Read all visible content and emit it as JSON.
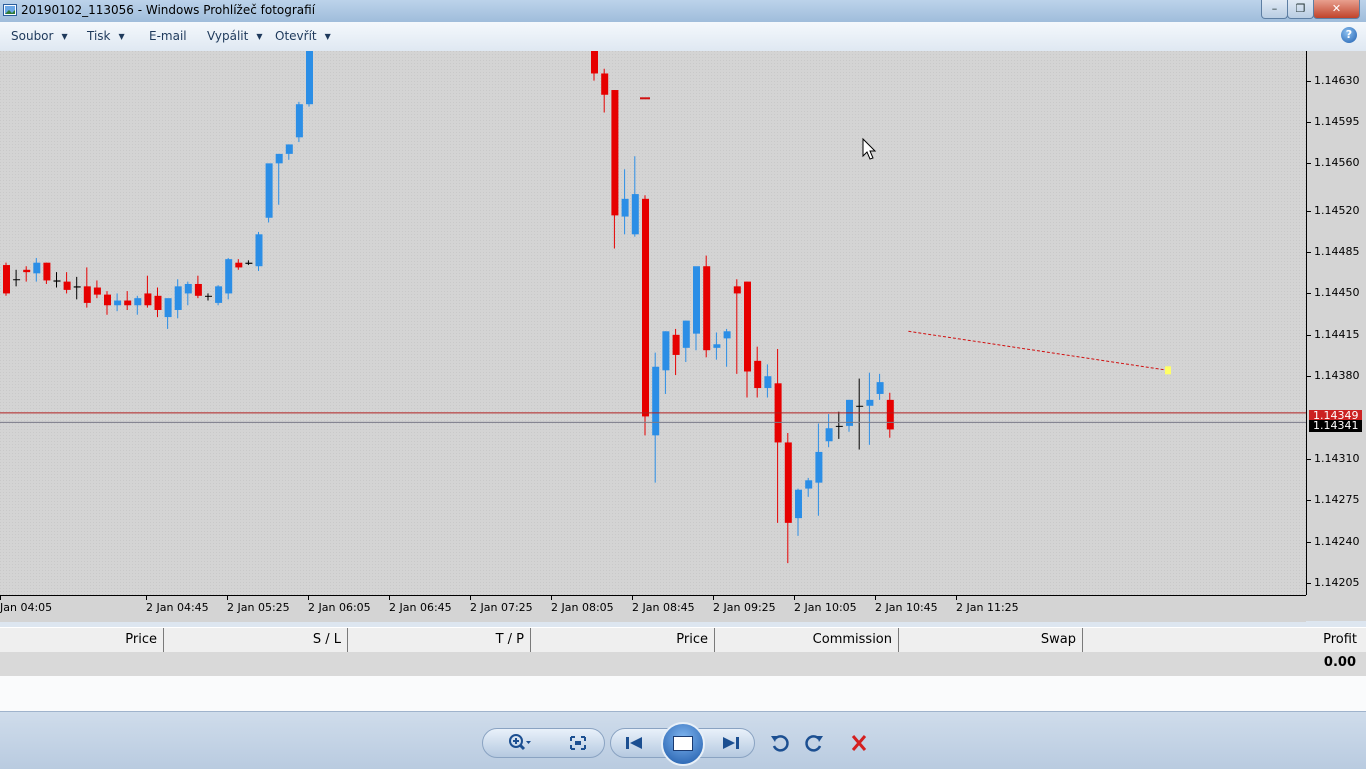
{
  "window": {
    "title": "20190102_113056 - Windows Prohlížeč fotografií",
    "controls": {
      "minimize": "–",
      "maximize": "❐",
      "close": "✕"
    }
  },
  "menu": {
    "items": [
      {
        "label": "Soubor",
        "dropdown": true
      },
      {
        "label": "Tisk",
        "dropdown": true
      },
      {
        "label": "E-mail",
        "dropdown": false
      },
      {
        "label": "Vypálit",
        "dropdown": true
      },
      {
        "label": "Otevřít",
        "dropdown": true
      }
    ],
    "help": "?"
  },
  "chart_data": {
    "type": "candlestick",
    "price_axis": [
      "1.14630",
      "1.14595",
      "1.14560",
      "1.14520",
      "1.14485",
      "1.14450",
      "1.14415",
      "1.14380",
      "1.14310",
      "1.14275",
      "1.14240",
      "1.14205"
    ],
    "time_axis": [
      "Jan 04:05",
      "2 Jan 04:45",
      "2 Jan 05:25",
      "2 Jan 06:05",
      "2 Jan 06:45",
      "2 Jan 07:25",
      "2 Jan 08:05",
      "2 Jan 08:45",
      "2 Jan 09:25",
      "2 Jan 10:05",
      "2 Jan 10:45",
      "2 Jan 11:25"
    ],
    "ylim": [
      1.14195,
      1.14655
    ],
    "bid_label": "1.14341",
    "ask_label": "1.14349",
    "bid_price": 1.14341,
    "ask_price": 1.14349,
    "up_color": "#2b8ee6",
    "down_color": "#e60000",
    "trendline": {
      "from": [
        63,
        1.14418
      ],
      "to": [
        86,
        1.14385
      ]
    },
    "candles": [
      [
        1.14474,
        1.14476,
        1.14448,
        1.1445
      ],
      [
        1.14462,
        1.1447,
        1.14456,
        1.14462
      ],
      [
        1.1447,
        1.14473,
        1.1446,
        1.14468
      ],
      [
        1.14467,
        1.1448,
        1.1446,
        1.14476
      ],
      [
        1.14476,
        1.14476,
        1.14458,
        1.14461
      ],
      [
        1.14461,
        1.14468,
        1.14455,
        1.1446
      ],
      [
        1.1446,
        1.14468,
        1.1445,
        1.14453
      ],
      [
        1.14455,
        1.14464,
        1.14445,
        1.14456
      ],
      [
        1.14456,
        1.14472,
        1.14438,
        1.14442
      ],
      [
        1.14455,
        1.14461,
        1.14446,
        1.14449
      ],
      [
        1.14449,
        1.14452,
        1.14432,
        1.1444
      ],
      [
        1.1444,
        1.1445,
        1.14435,
        1.14444
      ],
      [
        1.14444,
        1.14452,
        1.14436,
        1.1444
      ],
      [
        1.1444,
        1.14448,
        1.14432,
        1.14446
      ],
      [
        1.1445,
        1.14465,
        1.14438,
        1.1444
      ],
      [
        1.14448,
        1.14455,
        1.1443,
        1.14436
      ],
      [
        1.1443,
        1.1444,
        1.1442,
        1.14446
      ],
      [
        1.14436,
        1.14462,
        1.14429,
        1.14456
      ],
      [
        1.1445,
        1.1446,
        1.1444,
        1.14458
      ],
      [
        1.14458,
        1.14465,
        1.14446,
        1.14448
      ],
      [
        1.14448,
        1.1445,
        1.14444,
        1.14448
      ],
      [
        1.14442,
        1.14457,
        1.1444,
        1.14456
      ],
      [
        1.1445,
        1.1448,
        1.14445,
        1.14479
      ],
      [
        1.14476,
        1.14479,
        1.1447,
        1.14472
      ],
      [
        1.14476,
        1.14478,
        1.14474,
        1.14475
      ],
      [
        1.14473,
        1.14502,
        1.14469,
        1.145
      ],
      [
        1.14514,
        1.1454,
        1.1451,
        1.1456
      ],
      [
        1.1456,
        1.14568,
        1.14525,
        1.14568
      ],
      [
        1.14568,
        1.14576,
        1.14563,
        1.14576
      ],
      [
        1.14582,
        1.14612,
        1.14578,
        1.1461
      ],
      [
        1.1461,
        1.14655,
        1.14608,
        1.14655
      ],
      [
        1.14655,
        1.1466,
        1.1463,
        1.14636
      ],
      [
        1.14636,
        1.1464,
        1.14603,
        1.14618
      ],
      [
        1.14622,
        1.14622,
        1.14488,
        1.14516
      ],
      [
        1.14515,
        1.14555,
        1.145,
        1.1453
      ],
      [
        1.145,
        1.14566,
        1.14498,
        1.14534
      ],
      [
        1.1453,
        1.14533,
        1.1433,
        1.14346
      ],
      [
        1.1433,
        1.144,
        1.1429,
        1.14388
      ],
      [
        1.14385,
        1.14418,
        1.14365,
        1.14418
      ],
      [
        1.14415,
        1.1442,
        1.14381,
        1.14398
      ],
      [
        1.14404,
        1.14427,
        1.14392,
        1.14427
      ],
      [
        1.14416,
        1.14459,
        1.14402,
        1.14473
      ],
      [
        1.14473,
        1.14482,
        1.14396,
        1.14402
      ],
      [
        1.14404,
        1.14417,
        1.14394,
        1.14407
      ],
      [
        1.14412,
        1.1442,
        1.14388,
        1.14418
      ],
      [
        1.14456,
        1.14462,
        1.14382,
        1.1445
      ],
      [
        1.1446,
        1.1446,
        1.14362,
        1.14384
      ],
      [
        1.14393,
        1.14405,
        1.14362,
        1.1437
      ],
      [
        1.1437,
        1.1439,
        1.14362,
        1.1438
      ],
      [
        1.14374,
        1.14403,
        1.14256,
        1.14324
      ],
      [
        1.14324,
        1.14332,
        1.14222,
        1.14256
      ],
      [
        1.1426,
        1.14285,
        1.14245,
        1.14284
      ],
      [
        1.14285,
        1.14294,
        1.14278,
        1.14292
      ],
      [
        1.1429,
        1.1434,
        1.14262,
        1.14316
      ],
      [
        1.14325,
        1.14348,
        1.1432,
        1.14336
      ],
      [
        1.14338,
        1.1435,
        1.14327,
        1.14338
      ],
      [
        1.14338,
        1.1436,
        1.14333,
        1.1436
      ],
      [
        1.14355,
        1.14378,
        1.14318,
        1.14355
      ],
      [
        1.14355,
        1.14383,
        1.14322,
        1.1436
      ],
      [
        1.14365,
        1.14382,
        1.1436,
        1.14375
      ],
      [
        1.1436,
        1.14366,
        1.14328,
        1.14335
      ]
    ]
  },
  "terminal": {
    "columns": [
      "Price",
      "S / L",
      "T / P",
      "Price",
      "Commission",
      "Swap",
      "Profit"
    ],
    "profit_total": "0.00"
  },
  "toolbar": {
    "zoom": "zoom-icon",
    "fit": "fit-window-icon",
    "previous": "previous-icon",
    "slideshow": "slideshow-icon",
    "next": "next-icon",
    "rotate_ccw": "rotate-ccw-icon",
    "rotate_cw": "rotate-cw-icon",
    "delete": "delete-icon"
  }
}
